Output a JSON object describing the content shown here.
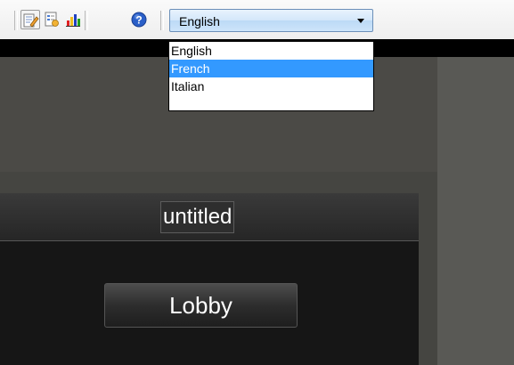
{
  "toolbar": {
    "buttons": [
      {
        "name": "edit-icon",
        "pressed": true
      },
      {
        "name": "properties-icon",
        "pressed": false
      },
      {
        "name": "chart-icon",
        "pressed": false
      },
      {
        "name": "help-icon",
        "pressed": false
      }
    ]
  },
  "language": {
    "selected": "English",
    "options": [
      "English",
      "French",
      "Italian"
    ],
    "highlighted": "French"
  },
  "panel": {
    "title": "untitled",
    "lobby_label": "Lobby"
  },
  "colors": {
    "highlight": "#3399ff",
    "canvas": "#4b4a46",
    "panel_body": "#161616"
  }
}
